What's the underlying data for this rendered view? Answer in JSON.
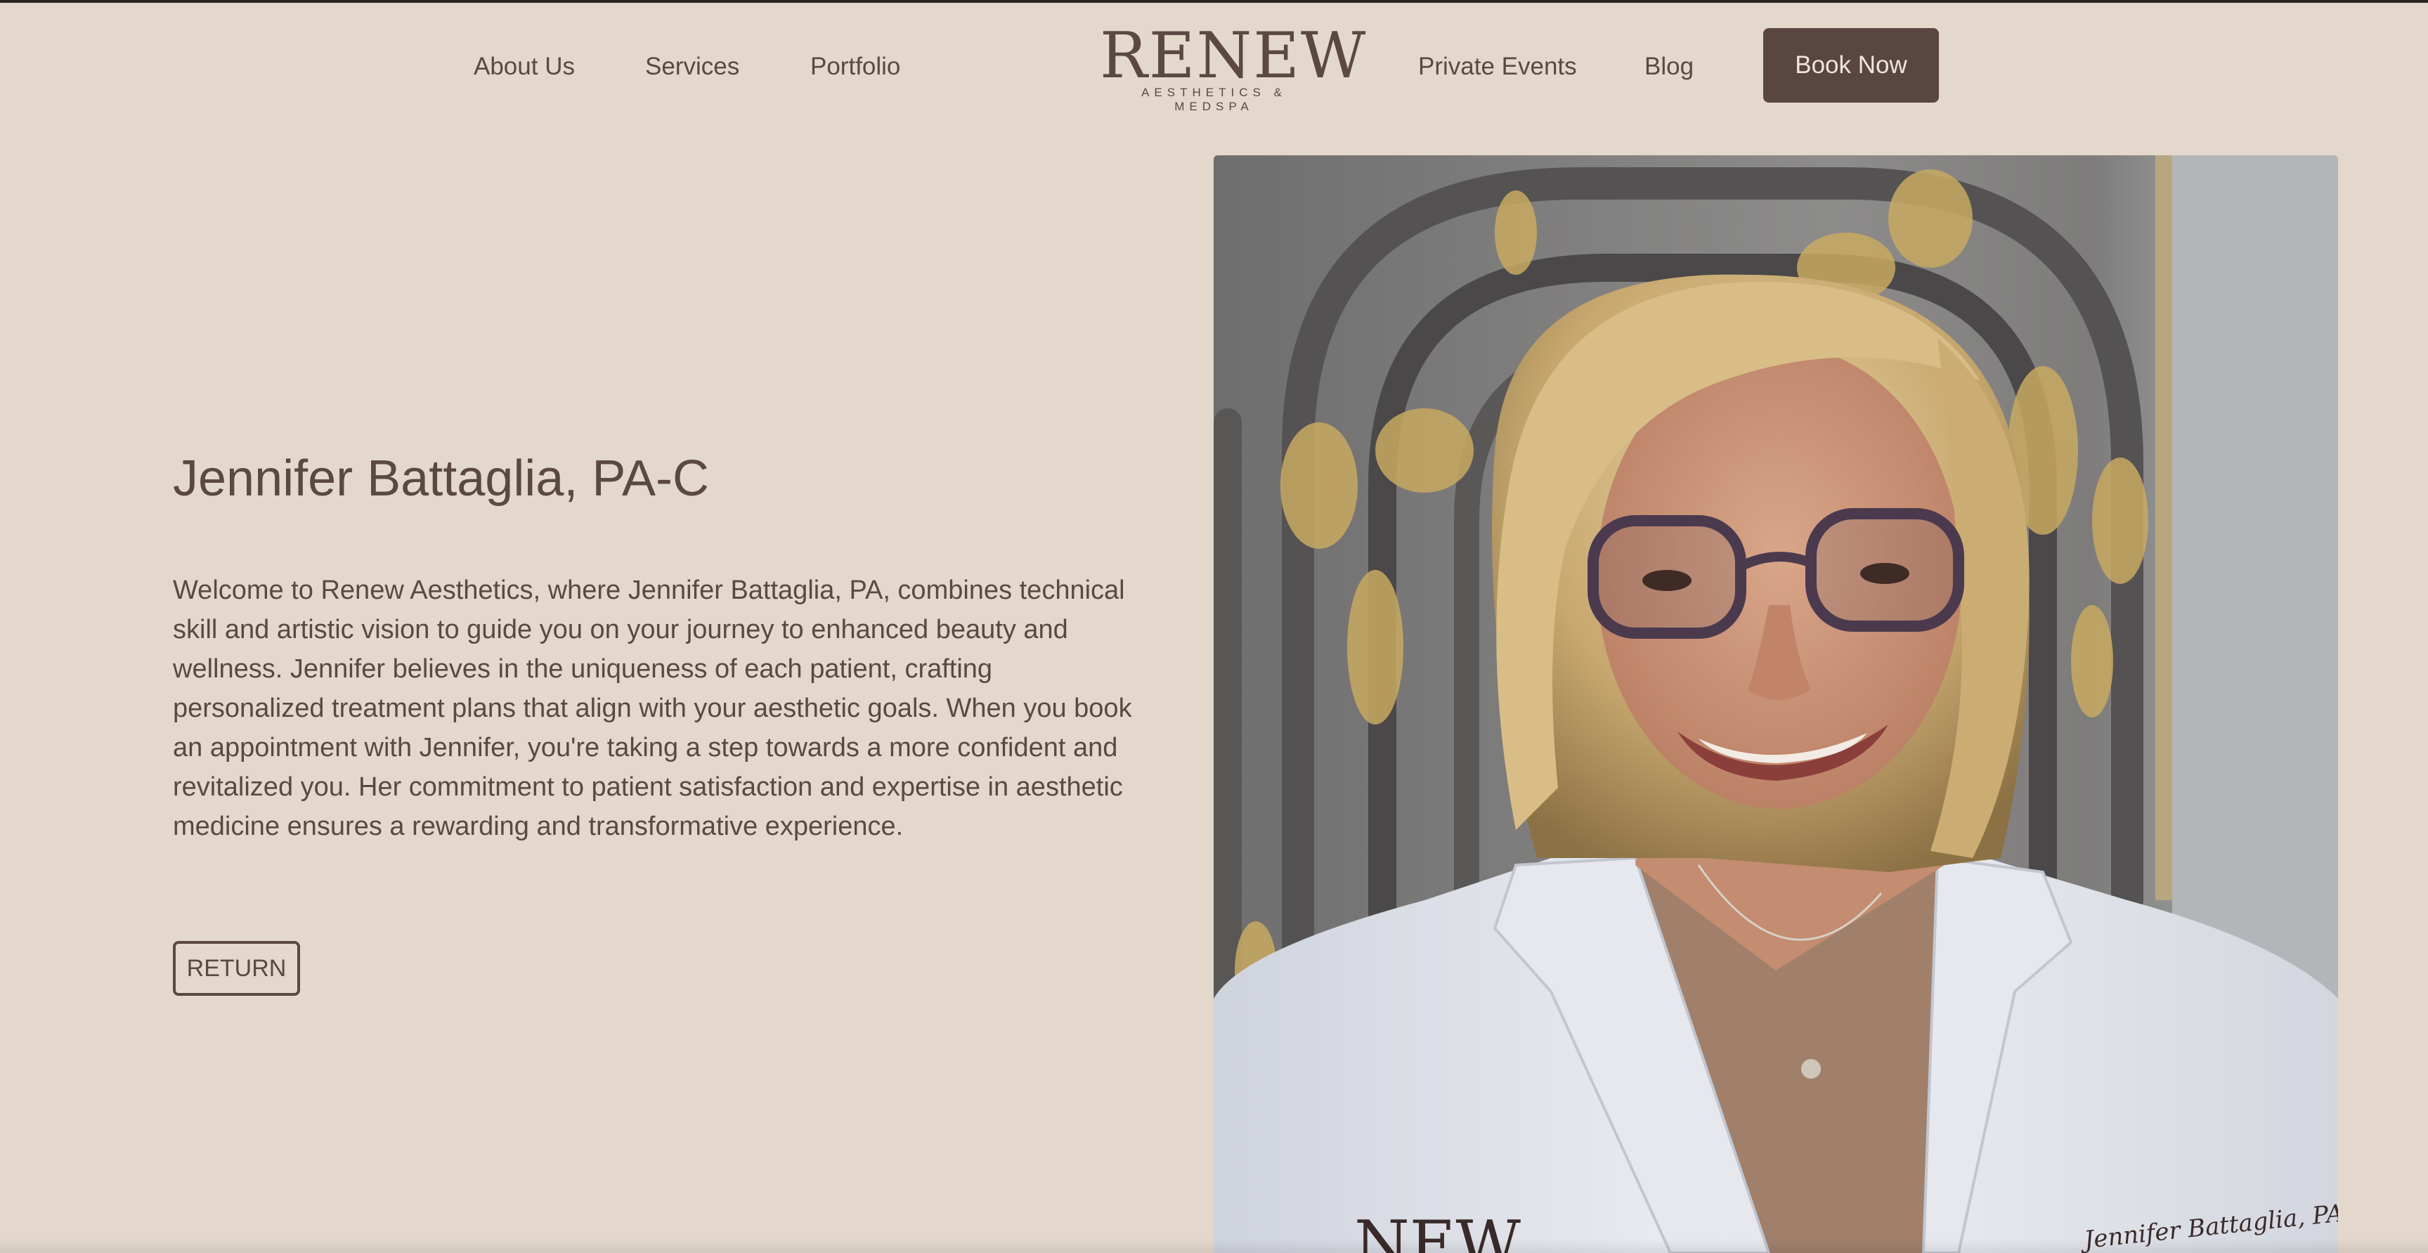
{
  "nav": {
    "left_links": [
      "About Us",
      "Services",
      "Portfolio"
    ],
    "right_links": [
      "Private Events",
      "Blog"
    ],
    "book_label": "Book Now"
  },
  "logo": {
    "wordmark": "RENEW",
    "tagline": "AESTHETICS & MEDSPA"
  },
  "profile": {
    "name": "Jennifer Battaglia, PA-C",
    "bio": "Welcome to Renew Aesthetics, where Jennifer Battaglia, PA, combines technical skill and artistic vision to guide you on your journey to enhanced beauty and wellness. Jennifer believes in the uniqueness of each patient, crafting personalized treatment plans that align with your aesthetic goals. When you book an appointment with Jennifer, you're taking a step towards a more confident and revitalized you. Her commitment to patient satisfaction and expertise in aesthetic medicine ensures a rewarding and transformative experience.",
    "return_label": "RETURN",
    "photo_alt": "Portrait of Jennifer Battaglia in a white coat"
  },
  "colors": {
    "background": "#e3d8cb",
    "text": "#5b4843",
    "button": "#5a4641",
    "button_text": "#efe6dc"
  }
}
